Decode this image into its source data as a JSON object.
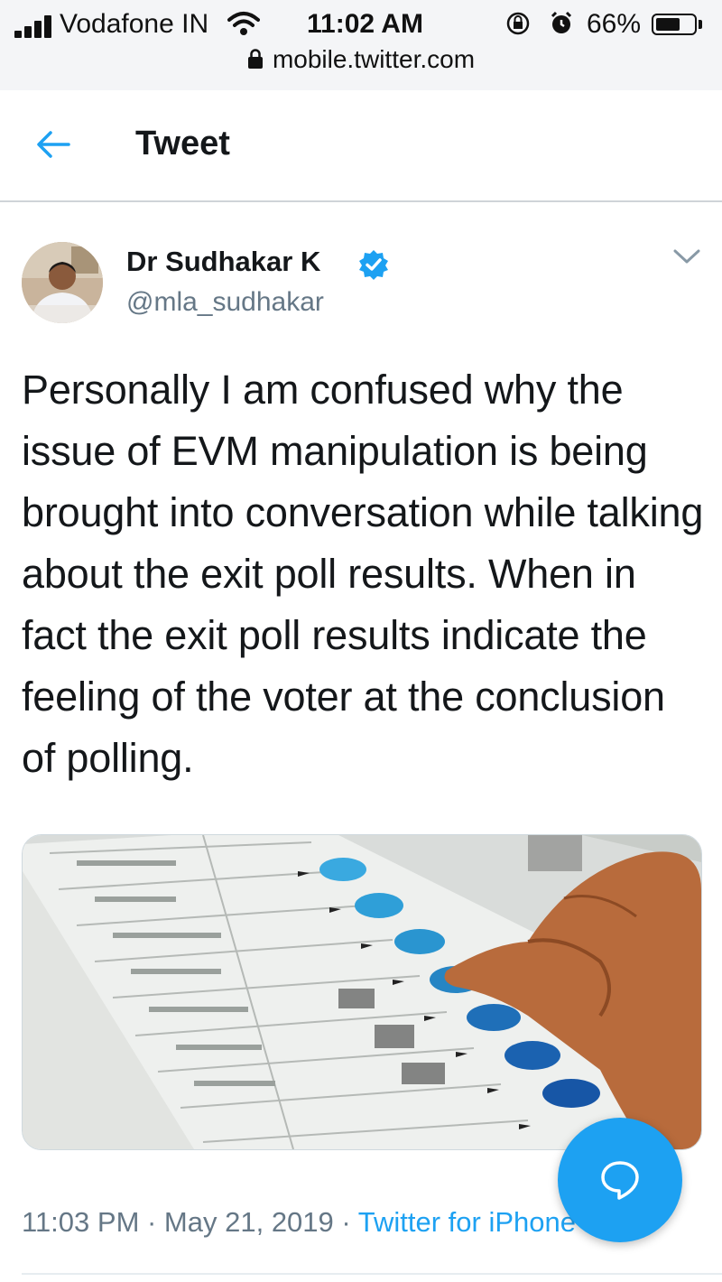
{
  "status_bar": {
    "carrier": "Vodafone IN",
    "time": "11:02 AM",
    "battery_percent": "66%",
    "battery_level": 0.66,
    "url": "mobile.twitter.com"
  },
  "header": {
    "title": "Tweet"
  },
  "tweet": {
    "author_name": "Dr Sudhakar K",
    "handle": "@mla_sudhakar",
    "verified": true,
    "text": "Personally I am confused why the issue of EVM manipulation is being brought into conversation while talking about the exit poll results. When in fact the exit poll results indicate the feeling of the voter at the conclusion of polling.",
    "timestamp": "11:03 PM · May 21, 2019 · ",
    "source": "Twitter for iPhone"
  },
  "colors": {
    "accent": "#1da1f2",
    "secondary_text": "#657786"
  },
  "icons": {
    "back": "arrow-left-icon",
    "verified": "verified-badge-icon",
    "caret": "chevron-down-icon",
    "compose": "reply-bubble-icon"
  }
}
